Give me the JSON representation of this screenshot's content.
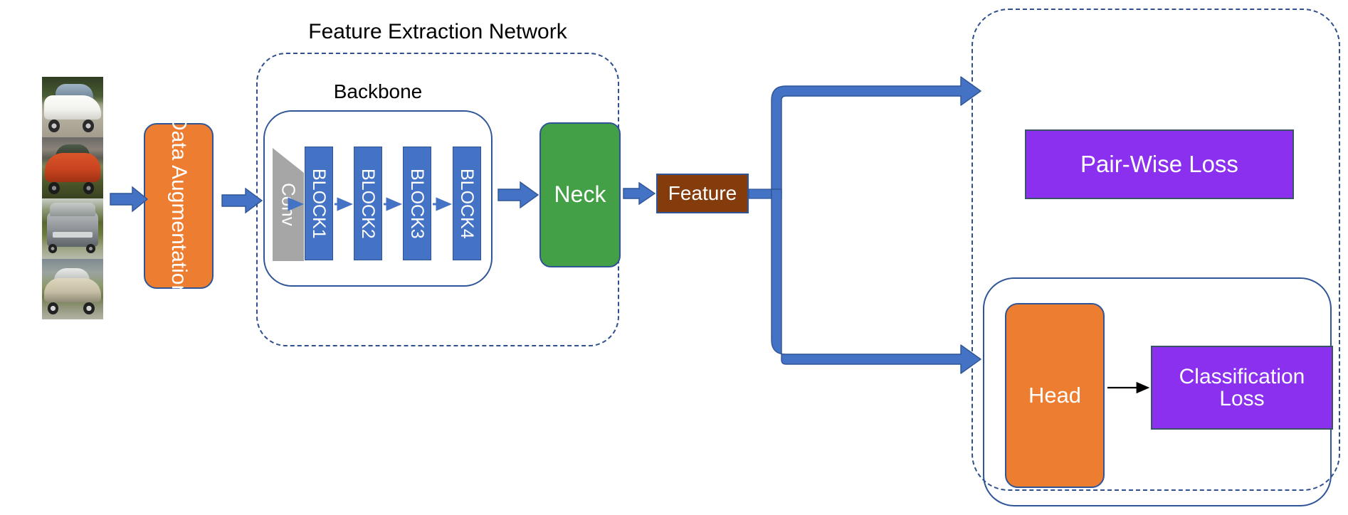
{
  "diagram": {
    "title_feature_extraction": "Feature Extraction Network",
    "title_backbone": "Backbone"
  },
  "input": {
    "name": "training-images",
    "photos": [
      {
        "label": "white-suv"
      },
      {
        "label": "red-hatchback"
      },
      {
        "label": "grey-suv"
      },
      {
        "label": "champagne-sedan"
      }
    ]
  },
  "pipeline": {
    "data_augmentation": "Data Augmentation",
    "conv": "Conv",
    "blocks": [
      "BLOCK1",
      "BLOCK2",
      "BLOCK3",
      "BLOCK4"
    ],
    "neck": "Neck",
    "feature": "Feature",
    "head": "Head"
  },
  "losses": {
    "pair_wise": "Pair-Wise Loss",
    "classification_line1": "Classification",
    "classification_line2": "Loss"
  },
  "colors": {
    "orange": "#ED7D31",
    "green": "#43A047",
    "brown": "#843C0C",
    "purple": "#8B30EF",
    "block_blue": "#4472C4",
    "conv_grey": "#A6A6A6",
    "arrow_blue": "#4472C4",
    "outline_blue": "#2f5597",
    "dash_blue": "#2f4f8f",
    "purple_border": "#3A5366",
    "black": "#000000"
  }
}
